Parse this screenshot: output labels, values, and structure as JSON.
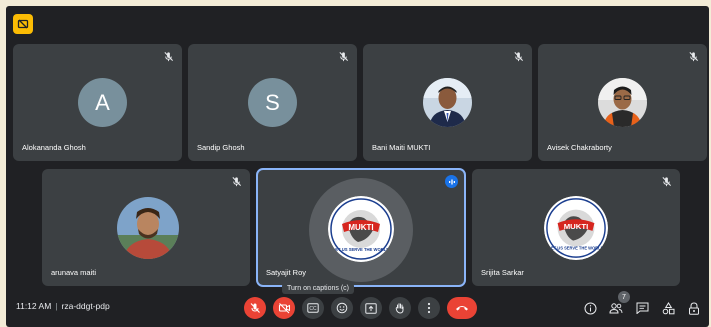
{
  "colors": {
    "background": "#202124",
    "tile": "#3c4043",
    "accent_blue": "#1a73e8",
    "active_outline": "#8ab4f8",
    "danger": "#ea4335",
    "badge_yellow": "#fbbc04"
  },
  "participants": [
    {
      "name": "Alokananda Ghosh",
      "initial": "A",
      "avatar_color": "#78909c",
      "muted": true
    },
    {
      "name": "Sandip Ghosh",
      "initial": "S",
      "avatar_color": "#78909c",
      "muted": true
    },
    {
      "name": "Bani Maiti MUKTI",
      "avatar": "photo",
      "muted": true
    },
    {
      "name": "Avisek Chakraborty",
      "avatar": "photo",
      "muted": true
    },
    {
      "name": "arunava maiti",
      "avatar": "photo",
      "muted": true
    },
    {
      "name": "Satyajit Roy",
      "avatar": "logo",
      "speaking": true
    },
    {
      "name": "Srijita Sarkar",
      "avatar": "logo",
      "muted": true
    }
  ],
  "logo_text": {
    "top": "MUKTI",
    "bottom": "LET US SERVE THE WORLD"
  },
  "meeting": {
    "time": "11:12 AM",
    "separator": "|",
    "code": "rza-ddgt-pdp"
  },
  "tooltip": "Turn on captions (c)",
  "controls": [
    {
      "name": "mic-off-button",
      "icon": "mic-off-icon",
      "state": "off"
    },
    {
      "name": "camera-off-button",
      "icon": "videocam-off-icon",
      "state": "off"
    },
    {
      "name": "captions-button",
      "icon": "closed-caption-icon"
    },
    {
      "name": "emoji-button",
      "icon": "emoji-icon"
    },
    {
      "name": "present-button",
      "icon": "present-screen-icon"
    },
    {
      "name": "raise-hand-button",
      "icon": "hand-icon"
    },
    {
      "name": "more-options-button",
      "icon": "more-vert-icon"
    },
    {
      "name": "leave-call-button",
      "icon": "call-end-icon"
    }
  ],
  "right_controls": [
    {
      "name": "meeting-details-button",
      "icon": "info-icon"
    },
    {
      "name": "people-button",
      "icon": "people-icon",
      "badge": "7"
    },
    {
      "name": "chat-button",
      "icon": "chat-icon"
    },
    {
      "name": "activities-button",
      "icon": "activities-icon"
    },
    {
      "name": "host-controls-button",
      "icon": "lock-person-icon"
    }
  ]
}
